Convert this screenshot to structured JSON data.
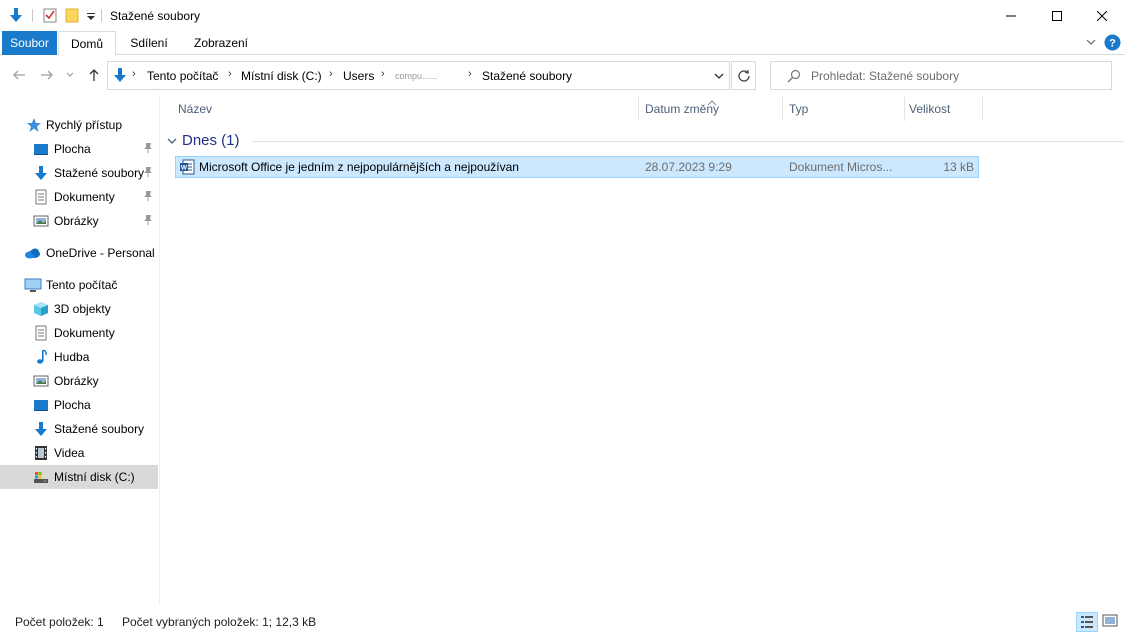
{
  "window": {
    "title": "Stažené soubory"
  },
  "ribbon": {
    "tabs": [
      "Soubor",
      "Domů",
      "Sdílení",
      "Zobrazení"
    ]
  },
  "address": {
    "crumbs": [
      "Tento počítač",
      "Místní disk (C:)",
      "Users",
      "compu......",
      "Stažené soubory"
    ]
  },
  "search": {
    "placeholder": "Prohledat: Stažené soubory"
  },
  "sidebar": {
    "quick_access": "Rychlý přístup",
    "quick_items": [
      "Plocha",
      "Stažené soubory",
      "Dokumenty",
      "Obrázky"
    ],
    "onedrive": "OneDrive - Personal",
    "this_pc": "Tento počítač",
    "pc_items": [
      "3D objekty",
      "Dokumenty",
      "Hudba",
      "Obrázky",
      "Plocha",
      "Stažené soubory",
      "Videa",
      "Místní disk (C:)"
    ]
  },
  "columns": {
    "name": "Název",
    "date": "Datum změny",
    "type": "Typ",
    "size": "Velikost"
  },
  "group": {
    "label": "Dnes (1)"
  },
  "files": [
    {
      "name": "Microsoft Office je jedním z nejpopulárnějších a nejpoužívan",
      "date": "28.07.2023 9:29",
      "type": "Dokument Micros...",
      "size": "13 kB"
    }
  ],
  "status": {
    "count": "Počet položek: 1",
    "selected": "Počet vybraných položek: 1; 12,3 kB"
  },
  "colors": {
    "accent": "#1979ca",
    "selection": "#cce8ff",
    "group_text": "#1e3287",
    "header_text": "#4c607a"
  }
}
